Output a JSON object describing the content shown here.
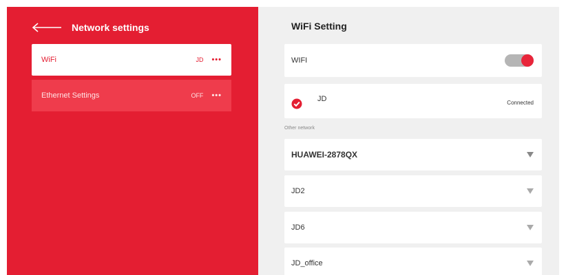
{
  "header": {
    "title": "Network settings"
  },
  "sidebar": {
    "items": [
      {
        "label": "WiFi",
        "value": "JD",
        "more": "•••"
      },
      {
        "label": "Ethernet Settings",
        "value": "OFF",
        "more": "•••"
      }
    ]
  },
  "wifi_panel": {
    "title": "WiFi Setting",
    "toggle_label": "WIFI",
    "toggle_on": true,
    "connected": {
      "name": "JD",
      "status": "Connected"
    },
    "other_label": "Other network",
    "networks": [
      {
        "name": "HUAWEI-2878QX"
      },
      {
        "name": "JD2"
      },
      {
        "name": "JD6"
      },
      {
        "name": "JD_office"
      }
    ]
  },
  "colors": {
    "accent": "#e41e32",
    "accent_light": "#ef3c4c",
    "panel_bg": "#f0f0f0"
  },
  "icons": [
    "back-arrow-icon",
    "more-dots-icon",
    "check-circle-icon",
    "wifi-signal-icon"
  ]
}
